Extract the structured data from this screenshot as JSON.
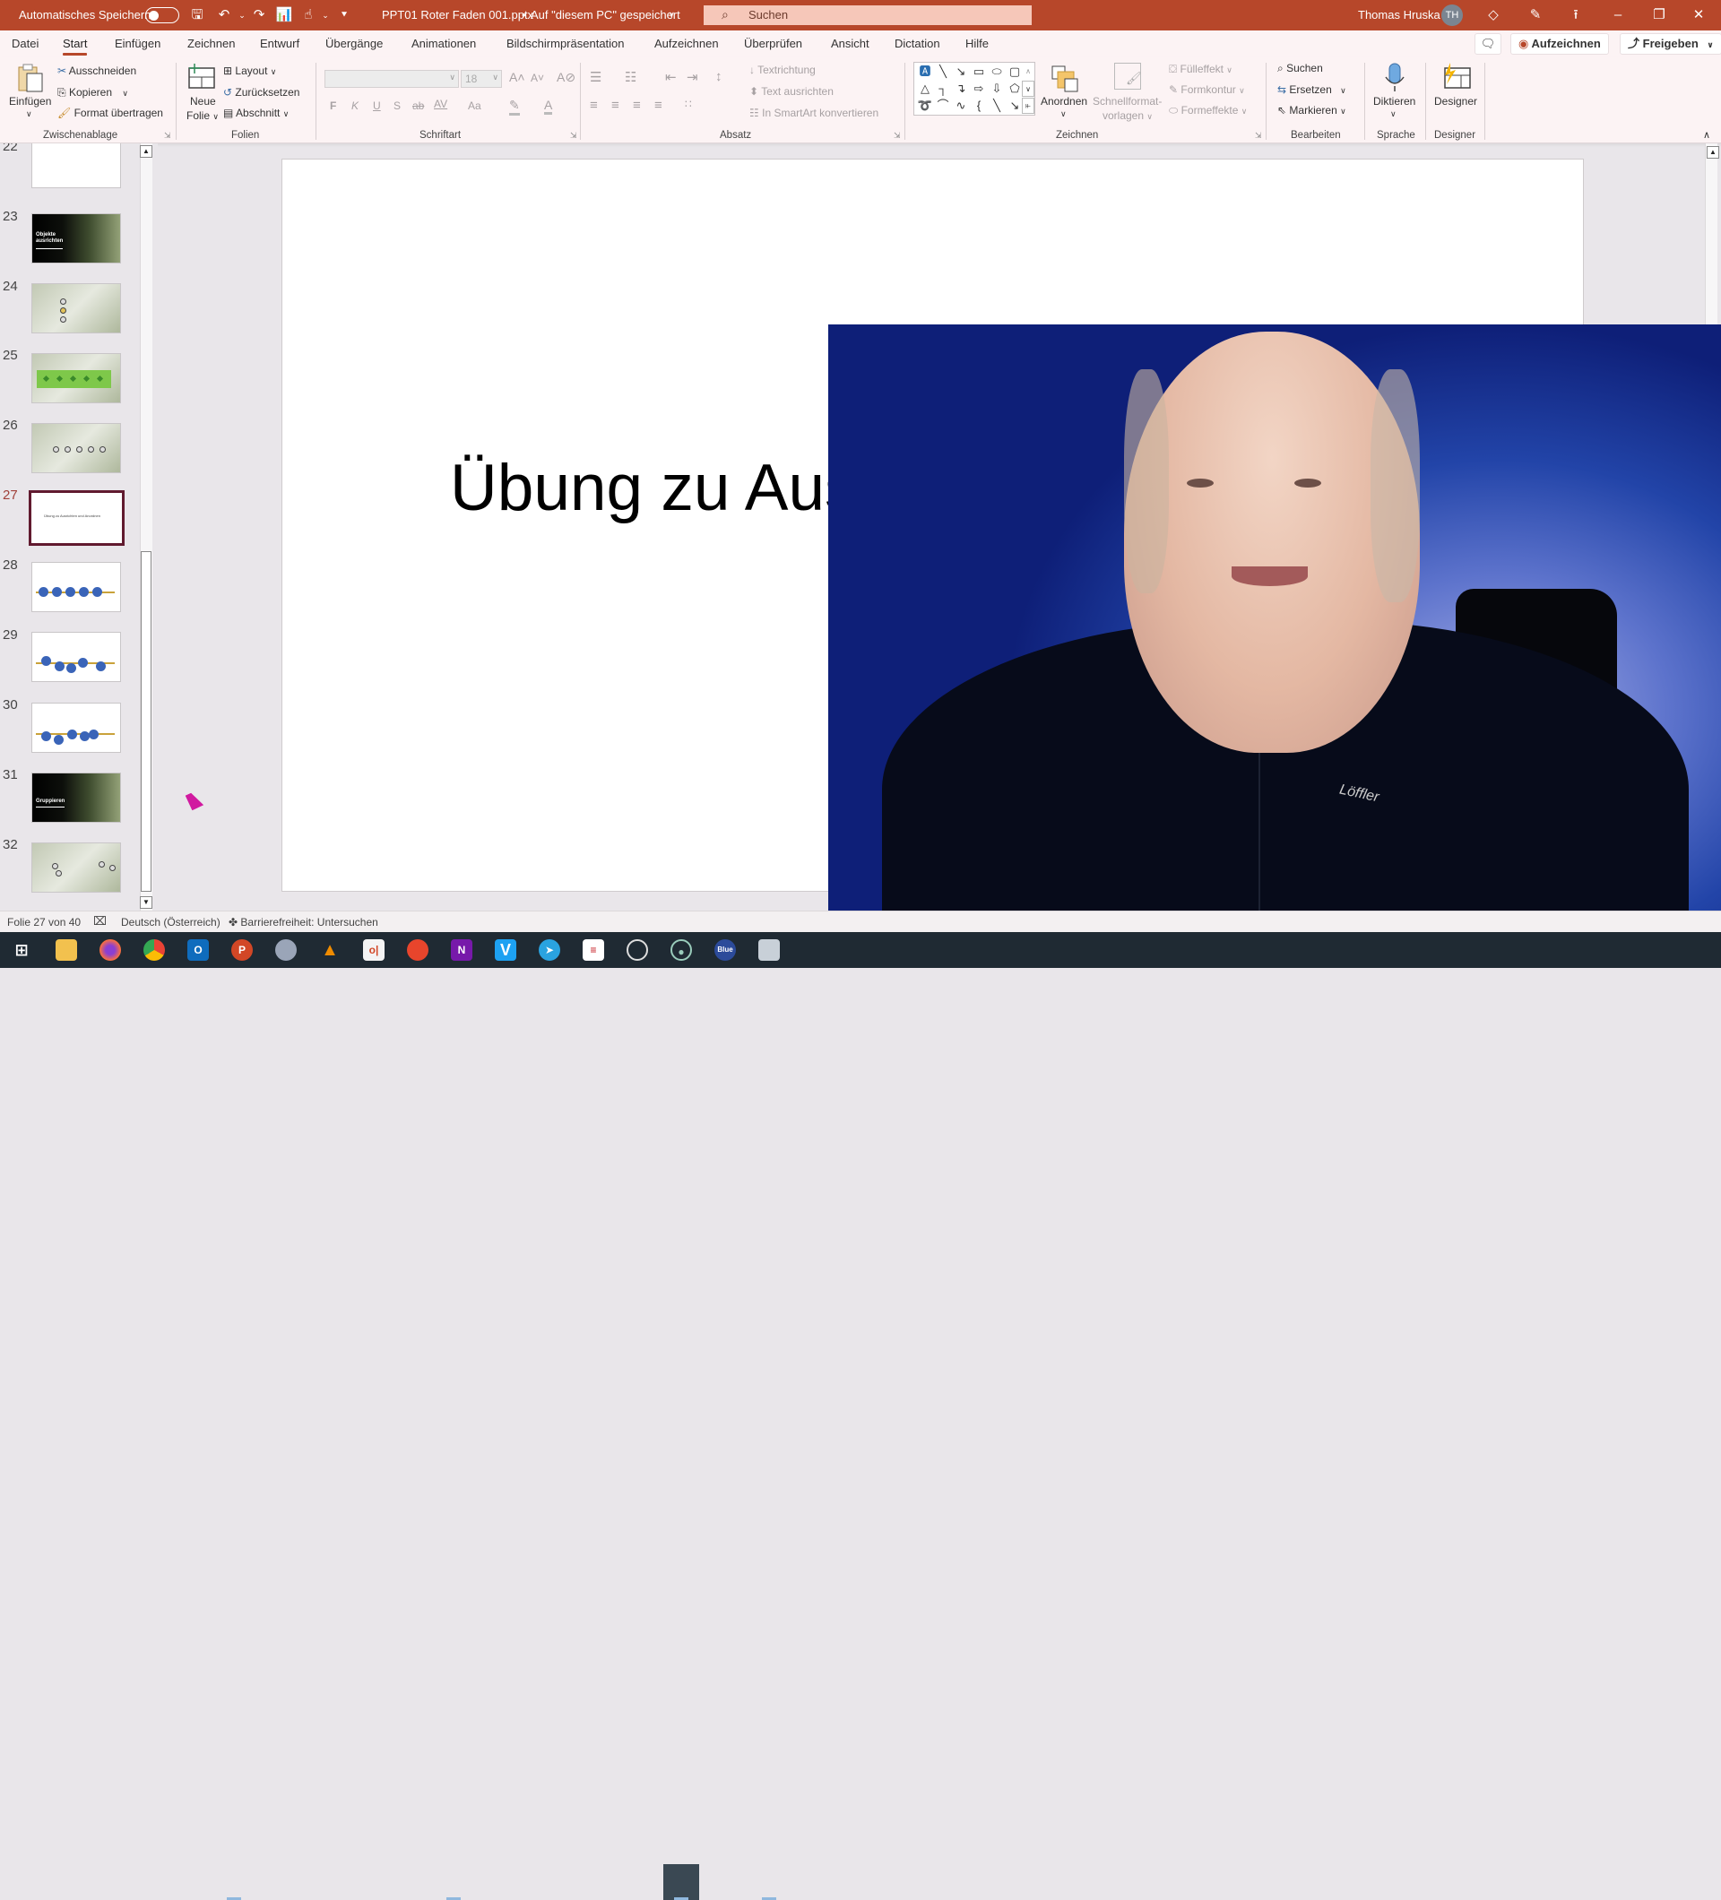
{
  "titlebar": {
    "autosave_label": "Automatisches Speichern",
    "autosave_state": "off",
    "document_title": "PPT01 Roter Faden 001.pptx",
    "save_location": "Auf \"diesem PC\" gespeichert",
    "search_placeholder": "Suchen",
    "user_name": "Thomas Hruska",
    "user_initials": "TH",
    "quick_access_icons": [
      "save-icon",
      "undo-icon",
      "redo-icon",
      "presentation-start-icon",
      "touch-mode-icon",
      "customize-icon"
    ],
    "window_controls": [
      "minimize",
      "restore",
      "close"
    ],
    "accent_color": "#b7472a"
  },
  "ribbon_tabs": {
    "items": [
      "Datei",
      "Start",
      "Einfügen",
      "Zeichnen",
      "Entwurf",
      "Übergänge",
      "Animationen",
      "Bildschirmpräsentation",
      "Aufzeichnen",
      "Überprüfen",
      "Ansicht",
      "Dictation",
      "Hilfe"
    ],
    "active": "Start",
    "record_button": "Aufzeichnen",
    "share_button": "Freigeben"
  },
  "ribbon": {
    "clipboard": {
      "label": "Zwischenablage",
      "paste": "Einfügen",
      "cut": "Ausschneiden",
      "copy": "Kopieren",
      "format_painter": "Format übertragen"
    },
    "slides": {
      "label": "Folien",
      "new_slide_line1": "Neue",
      "new_slide_line2": "Folie",
      "layout": "Layout",
      "reset": "Zurücksetzen",
      "section": "Abschnitt"
    },
    "font": {
      "label": "Schriftart",
      "font_name": "",
      "font_size": "18",
      "bold": "F",
      "italic": "K",
      "underline": "U",
      "shadow": "S",
      "strikethrough": "ab",
      "spacing": "AV",
      "case": "Aa"
    },
    "paragraph": {
      "label": "Absatz",
      "text_direction": "Textrichtung",
      "align_text": "Text ausrichten",
      "smartart": "In SmartArt konvertieren"
    },
    "drawing": {
      "label": "Zeichnen",
      "arrange": "Anordnen",
      "quick_styles_line1": "Schnellformat-",
      "quick_styles_line2": "vorlagen",
      "fill": "Fülleffekt",
      "outline": "Formkontur",
      "effects": "Formeffekte"
    },
    "editing": {
      "label": "Bearbeiten",
      "find": "Suchen",
      "replace": "Ersetzen",
      "select": "Markieren"
    },
    "voice": {
      "label": "Sprache",
      "dictate": "Diktieren"
    },
    "designer": {
      "label": "Designer",
      "button": "Designer"
    }
  },
  "thumbnails": [
    {
      "number": "22",
      "kind": "blank",
      "title": ""
    },
    {
      "number": "23",
      "kind": "dark",
      "title": "Objekte ausrichten"
    },
    {
      "number": "24",
      "kind": "photo",
      "title": ""
    },
    {
      "number": "25",
      "kind": "green",
      "title": ""
    },
    {
      "number": "26",
      "kind": "photo-emoji",
      "title": ""
    },
    {
      "number": "27",
      "kind": "selected",
      "title": "Übung zu Ausrichten und Anordnen"
    },
    {
      "number": "28",
      "kind": "balls",
      "title": ""
    },
    {
      "number": "29",
      "kind": "balls",
      "title": ""
    },
    {
      "number": "30",
      "kind": "balls",
      "title": ""
    },
    {
      "number": "31",
      "kind": "dark",
      "title": "Gruppieren"
    },
    {
      "number": "32",
      "kind": "photo-emoji",
      "title": ""
    }
  ],
  "selected_slide": "27",
  "slide": {
    "title_visible": "Übung zu Aus"
  },
  "statusbar": {
    "slide_position": "Folie 27 von 40",
    "language": "Deutsch (Österreich)",
    "accessibility": "Barrierefreiheit: Untersuchen"
  },
  "taskbar": {
    "apps": [
      "start",
      "file-explorer",
      "firefox",
      "chrome",
      "outlook",
      "powerpoint",
      "snipping-tool",
      "vlc",
      "office",
      "app-red",
      "onenote",
      "visio-v",
      "telegram",
      "acrobat",
      "obs",
      "recording-app",
      "blue-app",
      "monitor-app"
    ]
  },
  "webcam": {
    "description": "Presenter webcam overlay"
  }
}
